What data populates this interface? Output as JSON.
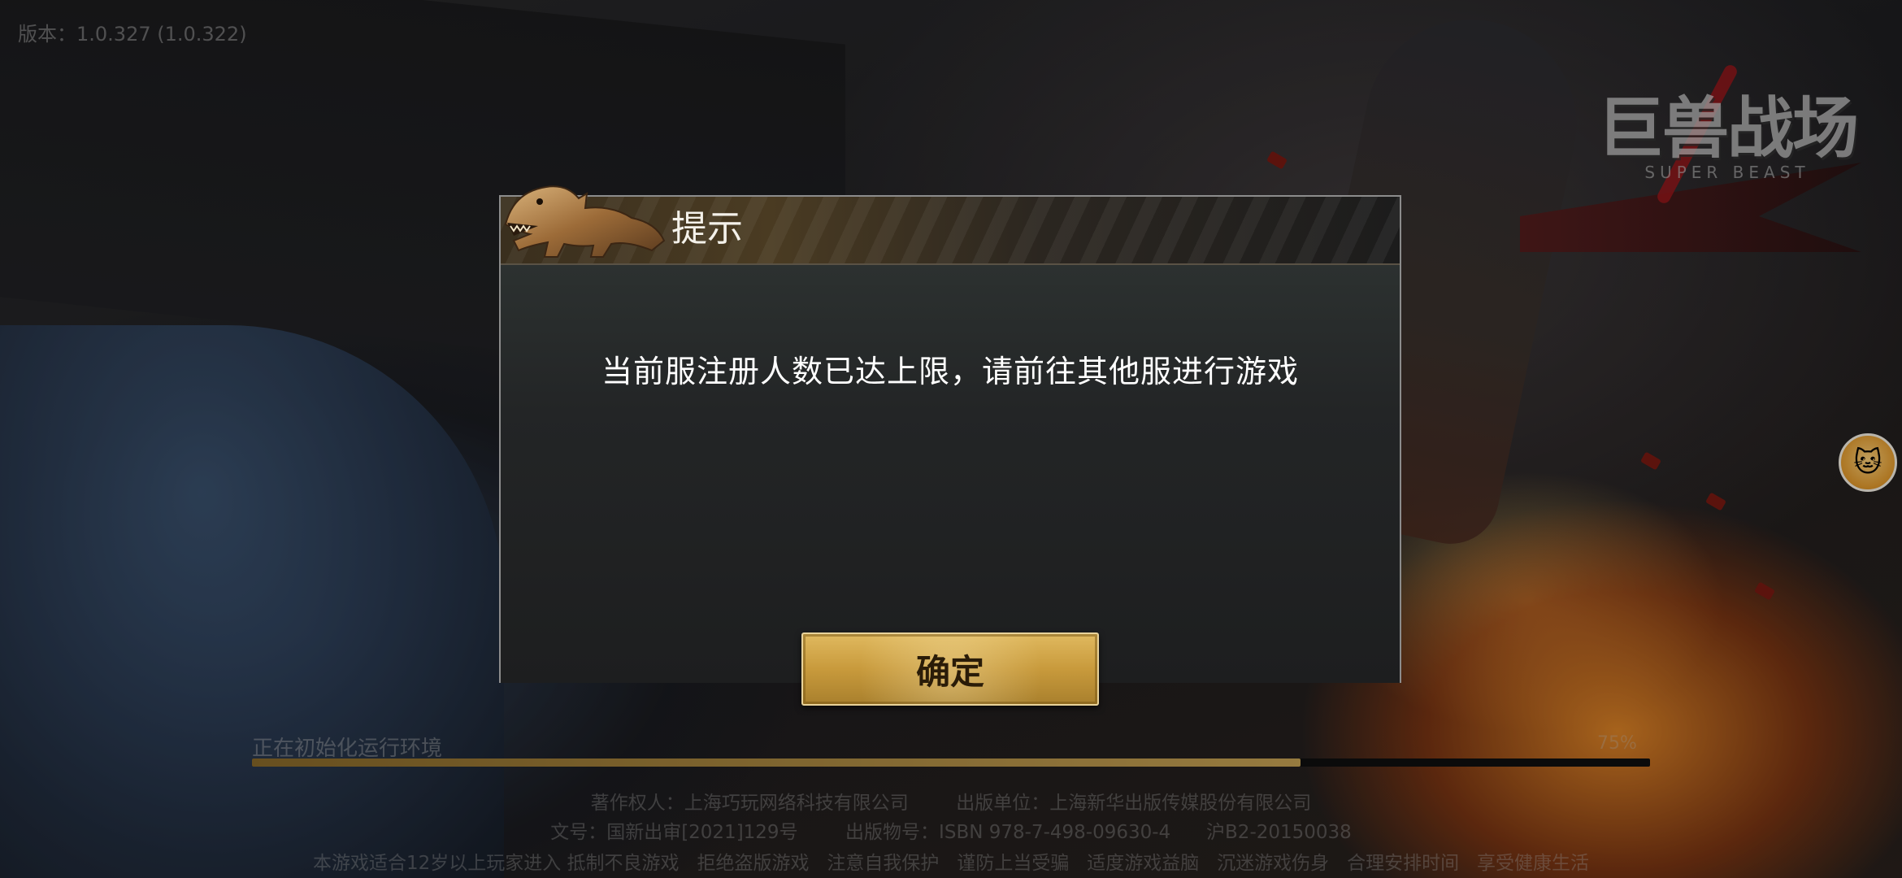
{
  "version_label": "版本：1.0.327 (1.0.322)",
  "logo": {
    "main": "巨兽战场",
    "sub": "SUPER BEAST"
  },
  "loading": {
    "status_text": "正在初始化运行环境",
    "percent_label": "75%",
    "progress": 0.75
  },
  "footer": {
    "line1": "著作权人：上海巧玩网络科技有限公司        出版单位：上海新华出版传媒股份有限公司",
    "line2": "文号：国新出审[2021]129号        出版物号：ISBN 978-7-498-09630-4      沪B2-20150038",
    "line3": "本游戏适合12岁以上玩家进入 抵制不良游戏   拒绝盗版游戏   注意自我保护   谨防上当受骗   适度游戏益脑   沉迷游戏伤身   合理安排时间   享受健康生活"
  },
  "dialog": {
    "title": "提示",
    "message": "当前服注册人数已达上限，请前往其他服进行游戏",
    "confirm_label": "确定"
  },
  "assistant_icon": "cat-mascot-icon"
}
